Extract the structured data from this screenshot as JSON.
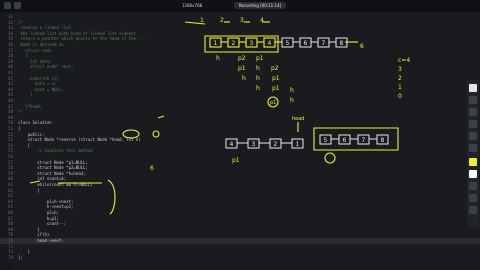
{
  "topbar": {
    "left_labels": [
      "◀",
      "⟲"
    ],
    "resolution": "1280x768",
    "recording": "Recording [00:11:14]"
  },
  "code": {
    "lines": [
      {
        "n": "31",
        "t": "",
        "c": "comment"
      },
      {
        "n": "32",
        "t": "/*",
        "c": "comment"
      },
      {
        "n": "33",
        "t": " reverse a linked list",
        "c": "comment"
      },
      {
        "n": "34",
        "t": " the linked list with head of linked list element",
        "c": "comment"
      },
      {
        "n": "35",
        "t": " return a pointer which points to the head of the ...",
        "c": "comment"
      },
      {
        "n": "36",
        "t": " Node is defined as",
        "c": "comment"
      },
      {
        "n": "37",
        "t": "   struct node",
        "c": "comment"
      },
      {
        "n": "38",
        "t": "   {",
        "c": "comment"
      },
      {
        "n": "39",
        "t": "     int data;",
        "c": "comment"
      },
      {
        "n": "40",
        "t": "     struct node* next;",
        "c": "comment"
      },
      {
        "n": "41",
        "t": "",
        "c": "comment"
      },
      {
        "n": "42",
        "t": "     node(int x){",
        "c": "comment"
      },
      {
        "n": "43",
        "t": "       data = x;",
        "c": "comment"
      },
      {
        "n": "44",
        "t": "       next = NULL;",
        "c": "comment"
      },
      {
        "n": "45",
        "t": "     }",
        "c": "comment"
      },
      {
        "n": "46",
        "t": "",
        "c": "comment"
      },
      {
        "n": "47",
        "t": "   }*head;",
        "c": "comment"
      },
      {
        "n": "48",
        "t": "*/",
        "c": "comment"
      },
      {
        "n": "49",
        "t": "",
        "c": "code"
      },
      {
        "n": "50",
        "t": "class Solution",
        "c": "code"
      },
      {
        "n": "51",
        "t": "{",
        "c": "code"
      },
      {
        "n": "52",
        "t": "    public:",
        "c": "code"
      },
      {
        "n": "53",
        "t": "    struct Node *reverse (struct Node *head, int k)",
        "c": "code"
      },
      {
        "n": "54",
        "t": "    {",
        "c": "code"
      },
      {
        "n": "55",
        "t": "        // Complete this method",
        "c": "comment"
      },
      {
        "n": "56",
        "t": "",
        "c": "code"
      },
      {
        "n": "57",
        "t": "        struct Node *p1=NULL;",
        "c": "code"
      },
      {
        "n": "58",
        "t": "        struct Node *p2=NULL;",
        "c": "code"
      },
      {
        "n": "59",
        "t": "        struct Node *h=head;",
        "c": "code"
      },
      {
        "n": "60",
        "t": "        int count=k;",
        "c": "code"
      },
      {
        "n": "61",
        "t": "        while(count && h!=NULL)",
        "c": "code"
      },
      {
        "n": "62",
        "t": "        {",
        "c": "code"
      },
      {
        "n": "63",
        "t": "",
        "c": "code"
      },
      {
        "n": "64",
        "t": "            p1=h->next;",
        "c": "code"
      },
      {
        "n": "65",
        "t": "            h->next=p2;",
        "c": "code"
      },
      {
        "n": "66",
        "t": "            p2=h;",
        "c": "code"
      },
      {
        "n": "67",
        "t": "            h=p1;",
        "c": "code"
      },
      {
        "n": "68",
        "t": "            count--;",
        "c": "code"
      },
      {
        "n": "69",
        "t": "        }",
        "c": "code"
      },
      {
        "n": "70",
        "t": "        if(h)",
        "c": "code"
      },
      {
        "n": "71",
        "t": "        head->next-",
        "c": "code"
      },
      {
        "n": "72",
        "t": "",
        "c": "code"
      },
      {
        "n": "73",
        "t": "    }",
        "c": "code"
      },
      {
        "n": "74",
        "t": "};",
        "c": "code"
      }
    ]
  },
  "annotations": {
    "top_nums": [
      "1",
      "2",
      "3",
      "4"
    ],
    "top_nodes": [
      "1",
      "2",
      "3",
      "4",
      "5",
      "6",
      "7",
      "8"
    ],
    "top_tail": "6",
    "right_list": [
      "c=4",
      "3",
      "2",
      "1",
      "0"
    ],
    "mid_nodes": [
      "4",
      "3",
      "2",
      "1"
    ],
    "mid_right_nodes": [
      "5",
      "6",
      "7",
      "8"
    ],
    "head_label": "head",
    "labels": [
      "h",
      "p2",
      "p1",
      "p1",
      "h",
      "p2",
      "h",
      "h",
      "p1",
      "h",
      "p1",
      "h",
      "p2",
      "h",
      "p1"
    ],
    "code_marks": [
      "4",
      "6"
    ]
  },
  "colors": {
    "ink": "#e9ef3a",
    "bg": "#1a1b1f"
  }
}
